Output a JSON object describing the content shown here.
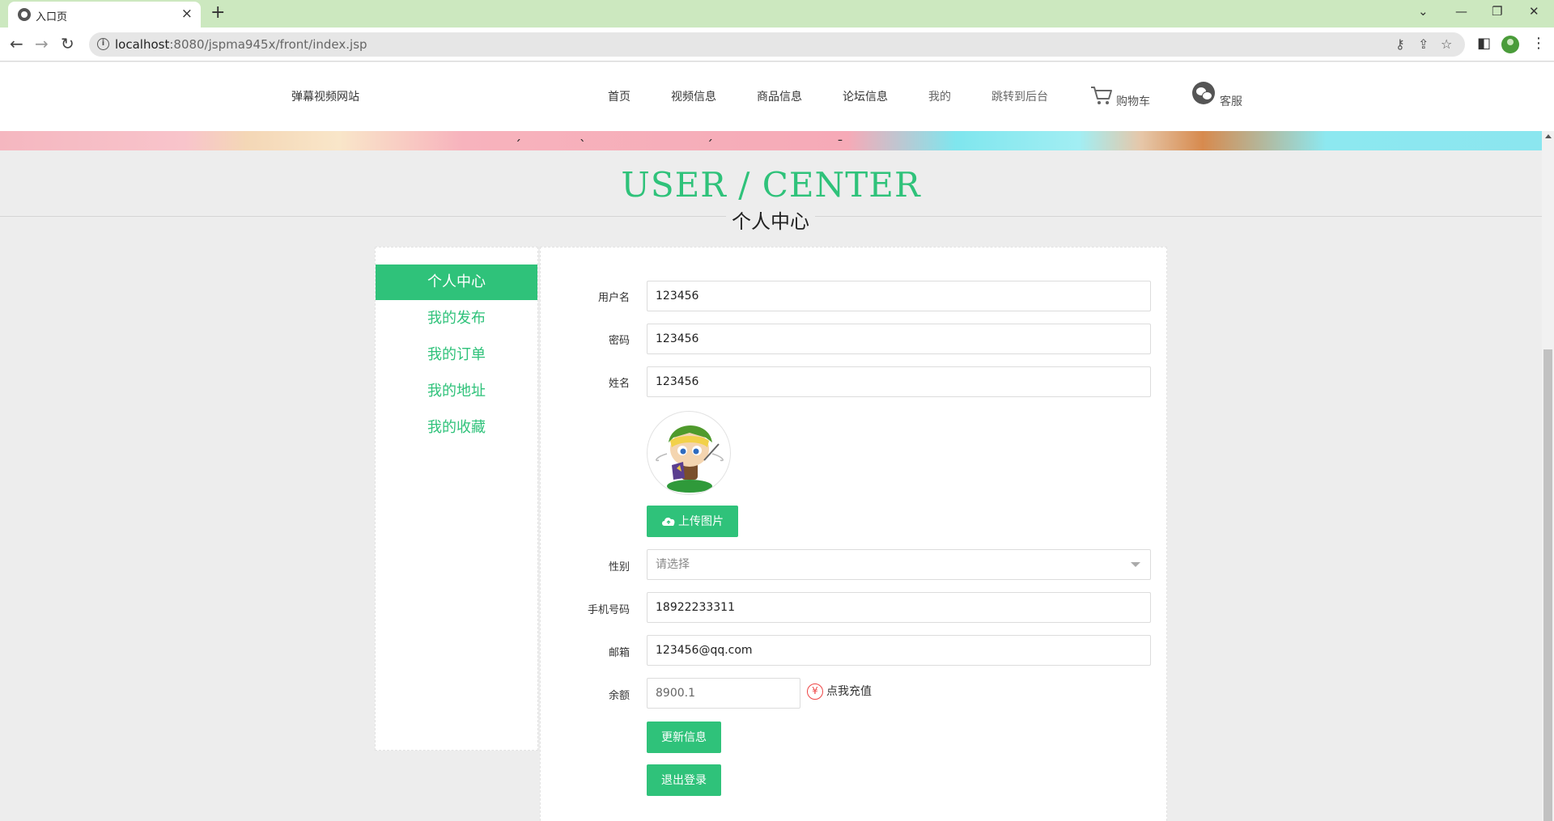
{
  "browser": {
    "tab_title": "入口页",
    "tab_close": "×",
    "new_tab": "+",
    "url_host": "localhost",
    "url_rest": ":8080/jspma945x/front/index.jsp"
  },
  "header": {
    "site_name": "弹幕视频网站",
    "nav": [
      {
        "label": "首页"
      },
      {
        "label": "视频信息"
      },
      {
        "label": "商品信息"
      },
      {
        "label": "论坛信息"
      },
      {
        "label": "我的"
      },
      {
        "label": "跳转到后台"
      }
    ],
    "cart_label": "购物车",
    "service_label": "客服"
  },
  "page": {
    "title_en": "USER / CENTER",
    "title_cn": "个人中心"
  },
  "side_menu": {
    "items": [
      {
        "label": "个人中心",
        "active": true
      },
      {
        "label": "我的发布"
      },
      {
        "label": "我的订单"
      },
      {
        "label": "我的地址"
      },
      {
        "label": "我的收藏"
      }
    ]
  },
  "form": {
    "username": {
      "label": "用户名",
      "value": "123456"
    },
    "password": {
      "label": "密码",
      "value": "123456"
    },
    "name": {
      "label": "姓名",
      "value": "123456"
    },
    "upload_label": "上传图片",
    "gender": {
      "label": "性别",
      "placeholder": "请选择"
    },
    "phone": {
      "label": "手机号码",
      "value": "18922233311"
    },
    "email": {
      "label": "邮箱",
      "value": "123456@qq.com"
    },
    "balance": {
      "label": "余额",
      "value": "8900.1"
    },
    "recharge_label": "点我充值",
    "recharge_symbol": "¥",
    "update_label": "更新信息",
    "logout_label": "退出登录"
  },
  "colors": {
    "accent": "#2fc27a",
    "tabbar": "#cce8bf"
  }
}
